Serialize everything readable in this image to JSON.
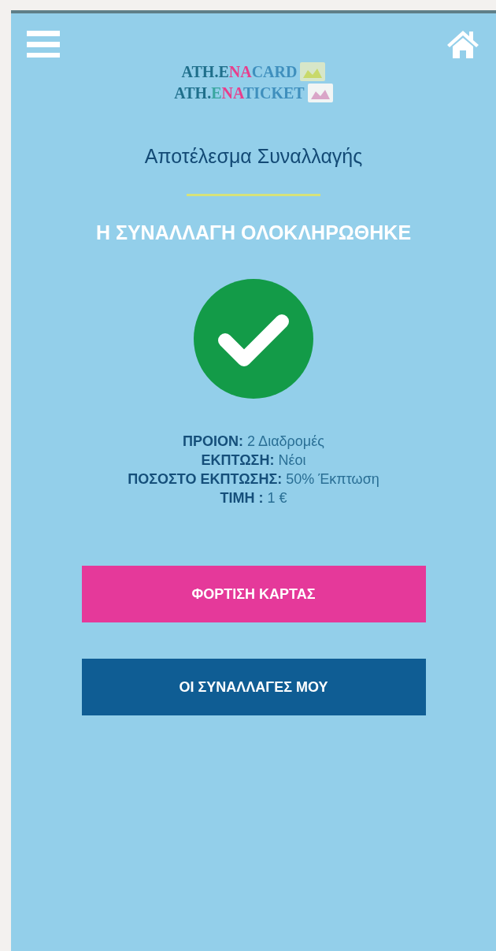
{
  "logo": [
    {
      "segments": [
        {
          "text": "ATH.",
          "color": "#1f6f8b"
        },
        {
          "text": "E",
          "color": "#1f6f8b"
        },
        {
          "text": "N",
          "color": "#e83e8c"
        },
        {
          "text": "A",
          "color": "#e83e8c"
        },
        {
          "text": "CARD",
          "color": "#3f8fbd"
        }
      ]
    },
    {
      "segments": [
        {
          "text": "ATH.",
          "color": "#1f6f8b"
        },
        {
          "text": "E",
          "color": "#3aa6a0"
        },
        {
          "text": "N",
          "color": "#e83e8c"
        },
        {
          "text": "A",
          "color": "#e83e8c"
        },
        {
          "text": "TICKET",
          "color": "#3f8fbd"
        }
      ]
    }
  ],
  "title": "Αποτέλεσμα Συναλλαγής",
  "status": "Η ΣΥΝΑΛΛΑΓΗ ΟΛΟΚΛΗΡΩΘΗΚΕ",
  "details": [
    "**ΠΡΟΙΟΝ:** 2 Διαδρομές",
    "**ΕΚΠΤΩΣΗ:** Νέοι",
    "**ΠΟΣΟΣΤΟ ΕΚΠΤΩΣΗΣ:** 50% Έκπτωση",
    "**ΤΙΜΗ :** 1 €"
  ],
  "buttons": [
    {
      "label": "ΦΟΡΤΙΣΗ ΚΑΡΤΑΣ",
      "kind": "primary"
    },
    {
      "label": "ΟΙ ΣΥΝΑΛΛΑΓΕΣ ΜΟΥ",
      "kind": "secondary"
    }
  ]
}
